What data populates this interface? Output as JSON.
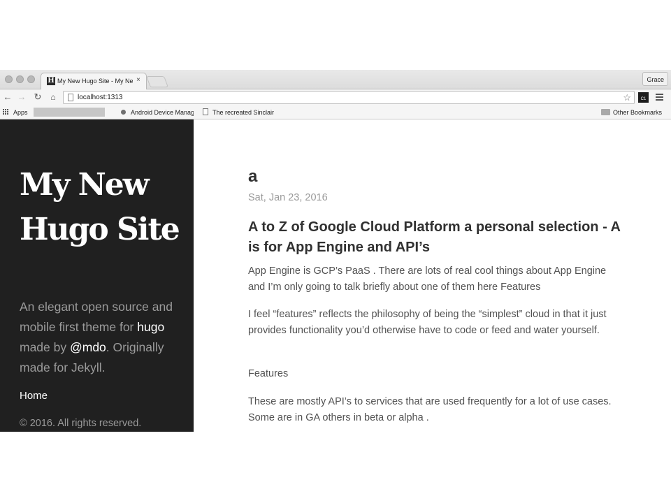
{
  "browser": {
    "tab": {
      "favicon": "H",
      "title": "My New Hugo Site - My New Hugo Site",
      "close": "×"
    },
    "profile_name": "Grace",
    "url": "localhost:1313",
    "extension_label": "C1",
    "bookmarks": {
      "apps": "Apps",
      "android": "Android Device Manager",
      "recreated": "The recreated Sinclair",
      "other": "Other Bookmarks"
    },
    "icons": {
      "back": "←",
      "forward": "→",
      "reload": "↻",
      "home": "⌂",
      "star": "☆"
    }
  },
  "sidebar": {
    "site_title": "My New Hugo Site",
    "tagline_start": "An elegant open source and mobile first theme for ",
    "tagline_hugo": "hugo",
    "tagline_mid": " made by ",
    "tagline_mdo": "@mdo",
    "tagline_end": ". Originally made for Jekyll.",
    "nav_home": "Home",
    "copyright": "© 2016. All rights reserved."
  },
  "post": {
    "title": "a",
    "date": "Sat, Jan 23, 2016",
    "heading": "A to Z of Google Cloud Platform a personal selection - A is for App Engine and API’s",
    "paragraphs": [
      "App Engine is GCP’s PaaS . There are lots of real cool things about App Engine and I’m only going to talk briefly about one of them here Features",
      "I feel “features” reflects the philosophy of being the “simplest” cloud in that it just provides functionality you’d otherwise have to code or feed and water yourself.",
      "Features",
      "These are mostly API’s to services that are used frequently for a lot of use cases. Some are in GA others in beta or alpha ."
    ]
  },
  "colors": {
    "sidebar_bg": "#202020",
    "sidebar_text": "#9a9a9a",
    "heading_text": "#313131",
    "body_text": "#515151"
  }
}
